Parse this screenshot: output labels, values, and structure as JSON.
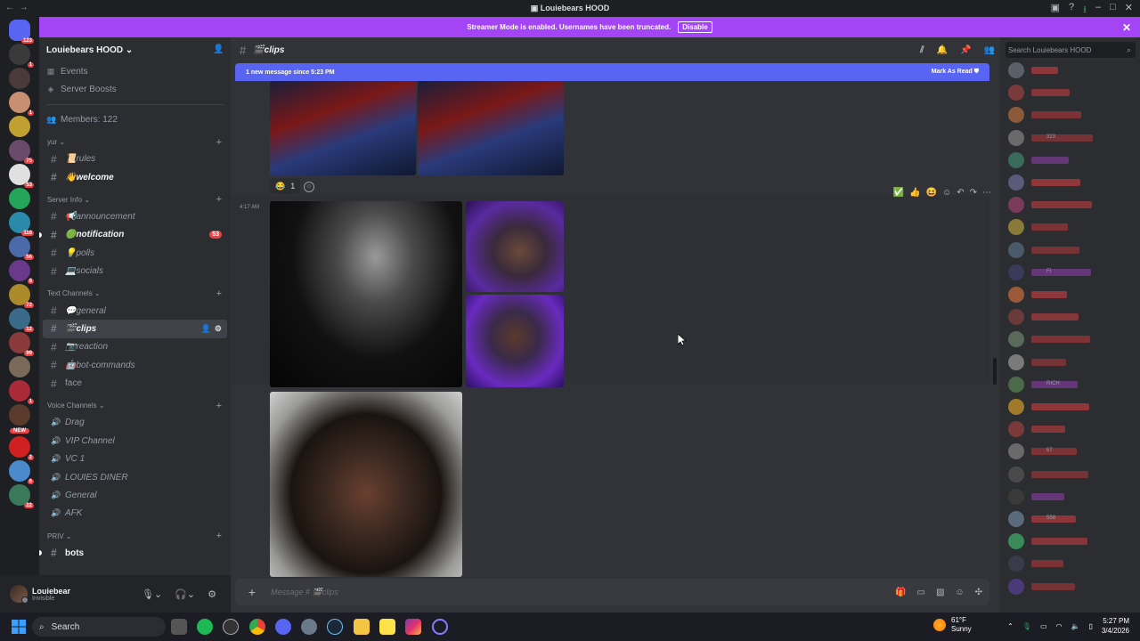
{
  "window": {
    "title": "Louiebears HOOD"
  },
  "banner": {
    "text": "Streamer Mode is enabled. Usernames have been truncated.",
    "disable_label": "Disable"
  },
  "guilds": [
    {
      "color": "#5865f2",
      "badge": "123"
    },
    {
      "color": "#3a3a3a",
      "badge": "1"
    },
    {
      "color": "#4a3a3a",
      "badge": ""
    },
    {
      "color": "#c89070",
      "badge": "1"
    },
    {
      "color": "#c0a030",
      "badge": ""
    },
    {
      "color": "#6a4a6a",
      "badge": "75"
    },
    {
      "color": "#e0e0e0",
      "badge": "53"
    },
    {
      "color": "#23a55a",
      "badge": ""
    },
    {
      "color": "#2a8aaa",
      "badge": "118"
    },
    {
      "color": "#4a6aaa",
      "badge": "56"
    },
    {
      "color": "#6a3a8a",
      "badge": "8"
    },
    {
      "color": "#aa8a2a",
      "badge": "72"
    },
    {
      "color": "#3a6a8a",
      "badge": "12"
    },
    {
      "color": "#8a3a3a",
      "badge": "99"
    },
    {
      "color": "#7a6a5a",
      "badge": ""
    },
    {
      "color": "#aa2a3a",
      "badge": "1"
    },
    {
      "color": "#5a3a2a",
      "badge": ""
    },
    {
      "color": "#d02020",
      "badge": "2"
    },
    {
      "color": "#4a8aca",
      "badge": "6"
    },
    {
      "color": "#3a7a5a",
      "badge": "22"
    }
  ],
  "guild_new_label": "NEW",
  "server": {
    "name": "Louiebears HOOD",
    "events_label": "Events",
    "boosts_label": "Server Boosts",
    "members_label": "Members: 122"
  },
  "categories": {
    "yur": "yur",
    "server_info": "Server Info",
    "text_channels": "Text Channels",
    "voice_channels": "Voice Channels",
    "priv": "PRIV"
  },
  "channels": {
    "rules": "📜rules",
    "welcome": "👋welcome",
    "announcement": "📢announcement",
    "notification": "🟢notification",
    "notification_badge": "53",
    "polls": "💡polls",
    "socials": "💻socials",
    "general": "💬general",
    "clips": "🎬clips",
    "reaction": "📷reaction",
    "bot_commands": "🤖bot-commands",
    "face": "face"
  },
  "voice_channels": [
    "Drag",
    "VIP Channel",
    "VC 1",
    "LOUIES DINER",
    "General",
    "AFK"
  ],
  "priv_channels": {
    "bots": "bots"
  },
  "user": {
    "name": "Louiebear",
    "status": "Invisible"
  },
  "chat": {
    "channel_name": "🎬clips",
    "new_messages_text": "1 new message since 5:23 PM",
    "mark_read_label": "Mark As Read",
    "reaction_count": "1",
    "timestamp": "4:17 AM",
    "composer_placeholder": "Message # 🎬clips"
  },
  "members_panel": {
    "search_placeholder": "Search Louiebears HOOD",
    "tags": [
      "323",
      "FI",
      "RICH",
      "67",
      "558"
    ]
  },
  "taskbar": {
    "search_label": "Search",
    "temperature": "61°F",
    "condition": "Sunny",
    "time": "5:27 PM",
    "date": "3/4/2026"
  }
}
